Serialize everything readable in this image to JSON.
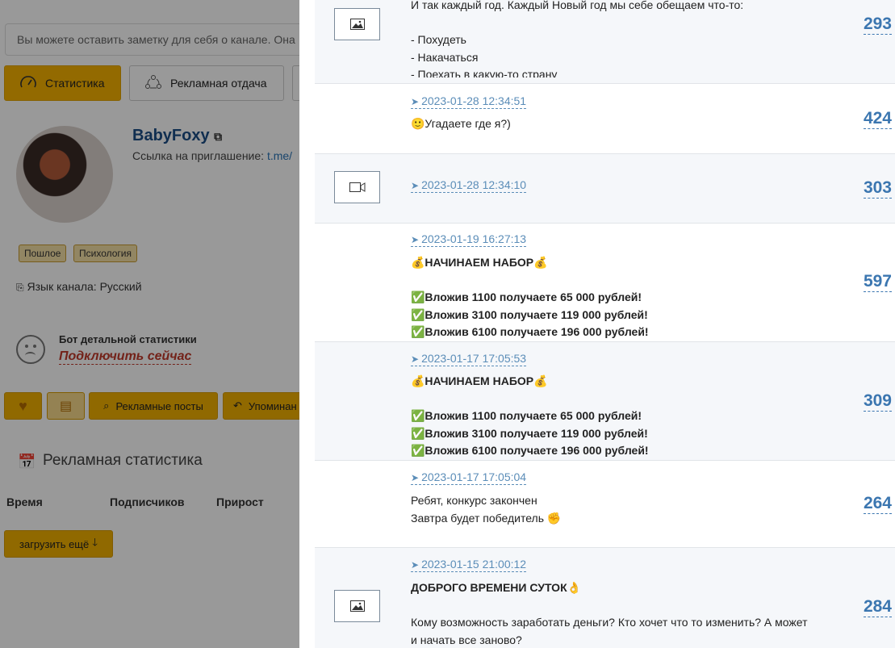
{
  "background": {
    "note_placeholder": "Вы можете оставить заметку для себя о канале. Она",
    "tabs": [
      {
        "label": "Статистика",
        "icon": "speedometer-icon"
      },
      {
        "label": "Рекламная отдача",
        "icon": "share-icon"
      }
    ],
    "channel": {
      "name": "BabyFoxy",
      "invite_label": "Ссылка на приглашение:",
      "invite_link": "t.me/",
      "tags": [
        "Пошлое",
        "Психология"
      ],
      "language": "Язык канала: Русский"
    },
    "bot": {
      "title": "Бот детальной статистики",
      "link": "Подключить сейчас"
    },
    "action_buttons": {
      "ads_posts": "Рекламные посты",
      "mentions": "Упоминан"
    },
    "ad_stats": {
      "title": "Рекламная статистика",
      "columns": [
        "Время",
        "Подписчиков",
        "Прирост"
      ],
      "load_more": "загрузить ещё"
    }
  },
  "posts": [
    {
      "media": "image-icon",
      "date": "",
      "text": "И так каждый год. Каждый Новый год мы себе обещаем что-то:\n\n- Похудеть\n- Накачаться\n- Поехать в какую-то страну",
      "bold": false,
      "views": "293"
    },
    {
      "media": "",
      "date": "2023-01-28 12:34:51",
      "text": "🙂Угадаете где я?)",
      "bold": false,
      "views": "424"
    },
    {
      "media": "video-icon",
      "date": "2023-01-28 12:34:10",
      "text": "",
      "bold": false,
      "views": "303"
    },
    {
      "media": "",
      "date": "2023-01-19 16:27:13",
      "text": "💰НАЧИНАЕМ НАБОР💰\n\n✅Вложив 1100 получаете 65 000 рублей!\n✅Вложив 3100 получаете 119 000 рублей!\n✅Вложив 6100 получаете 196 000 рублей!",
      "bold": true,
      "views": "597"
    },
    {
      "media": "",
      "date": "2023-01-17 17:05:53",
      "text": "💰НАЧИНАЕМ НАБОР💰\n\n✅Вложив 1100 получаете 65 000 рублей!\n✅Вложив 3100 получаете 119 000 рублей!\n✅Вложив 6100 получаете 196 000 рублей!",
      "bold": true,
      "views": "309"
    },
    {
      "media": "",
      "date": "2023-01-17 17:05:04",
      "text": "Ребят, конкурс закончен\nЗавтра будет победитель ✊",
      "bold": false,
      "views": "264"
    },
    {
      "media": "image-icon",
      "date": "2023-01-15 21:00:12",
      "text_bold": "ДОБРОГО ВРЕМЕНИ СУТОК👌",
      "text": "Кому возможность заработать деньги? Кто хочет что то изменить? А может\nи начать все заново?",
      "bold": false,
      "views": "284"
    }
  ],
  "colors": {
    "accent": "#f0b000",
    "link": "#3b76b0",
    "date": "#5b8db8"
  }
}
